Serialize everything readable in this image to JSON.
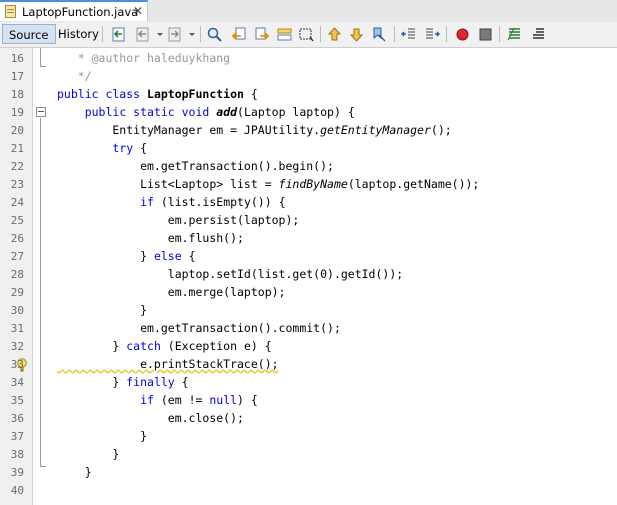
{
  "tab": {
    "title": "LaptopFunction.java",
    "close_glyph": "✕"
  },
  "toolbar": {
    "source_label": "Source",
    "history_label": "History"
  },
  "lines": [
    {
      "num": "16",
      "segs": [
        {
          "t": "   * @author haleduykhang",
          "c": "cmt"
        }
      ]
    },
    {
      "num": "17",
      "segs": [
        {
          "t": "   */",
          "c": "cmt"
        }
      ]
    },
    {
      "num": "18",
      "segs": [
        {
          "t": "public class ",
          "c": "kw"
        },
        {
          "t": "LaptopFunction",
          "c": "bold"
        },
        {
          "t": " {",
          "c": ""
        }
      ]
    },
    {
      "num": "19",
      "segs": [
        {
          "t": "    ",
          "c": ""
        },
        {
          "t": "public static void ",
          "c": "kw"
        },
        {
          "t": "add",
          "c": "bold ital"
        },
        {
          "t": "(Laptop laptop) {",
          "c": ""
        }
      ]
    },
    {
      "num": "20",
      "segs": [
        {
          "t": "        EntityManager em = JPAUtility.",
          "c": ""
        },
        {
          "t": "getEntityManager",
          "c": "ital"
        },
        {
          "t": "();",
          "c": ""
        }
      ]
    },
    {
      "num": "21",
      "segs": [
        {
          "t": "        ",
          "c": ""
        },
        {
          "t": "try",
          "c": "kw"
        },
        {
          "t": " {",
          "c": ""
        }
      ]
    },
    {
      "num": "22",
      "segs": [
        {
          "t": "            em.getTransaction().begin();",
          "c": ""
        }
      ]
    },
    {
      "num": "23",
      "segs": [
        {
          "t": "            List<Laptop> list = ",
          "c": ""
        },
        {
          "t": "findByName",
          "c": "ital"
        },
        {
          "t": "(laptop.getName());",
          "c": ""
        }
      ]
    },
    {
      "num": "24",
      "segs": [
        {
          "t": "            ",
          "c": ""
        },
        {
          "t": "if",
          "c": "kw"
        },
        {
          "t": " (list.isEmpty()) {",
          "c": ""
        }
      ]
    },
    {
      "num": "25",
      "segs": [
        {
          "t": "                em.persist(laptop);",
          "c": ""
        }
      ]
    },
    {
      "num": "26",
      "segs": [
        {
          "t": "                em.flush();",
          "c": ""
        }
      ]
    },
    {
      "num": "27",
      "segs": [
        {
          "t": "            } ",
          "c": ""
        },
        {
          "t": "else",
          "c": "kw"
        },
        {
          "t": " {",
          "c": ""
        }
      ]
    },
    {
      "num": "28",
      "segs": [
        {
          "t": "                laptop.setId(list.get(0).getId());",
          "c": ""
        }
      ]
    },
    {
      "num": "29",
      "segs": [
        {
          "t": "                em.merge(laptop);",
          "c": ""
        }
      ]
    },
    {
      "num": "30",
      "segs": [
        {
          "t": "            }",
          "c": ""
        }
      ]
    },
    {
      "num": "31",
      "segs": [
        {
          "t": "            em.getTransaction().commit();",
          "c": ""
        }
      ]
    },
    {
      "num": "32",
      "segs": [
        {
          "t": "        } ",
          "c": ""
        },
        {
          "t": "catch",
          "c": "kw"
        },
        {
          "t": " (Exception e) {",
          "c": ""
        }
      ]
    },
    {
      "num": "33",
      "segs": [
        {
          "t": "            e.printStackTrace();",
          "c": ""
        }
      ]
    },
    {
      "num": "34",
      "segs": [
        {
          "t": "        } ",
          "c": ""
        },
        {
          "t": "finally",
          "c": "kw"
        },
        {
          "t": " {",
          "c": ""
        }
      ]
    },
    {
      "num": "35",
      "segs": [
        {
          "t": "            ",
          "c": ""
        },
        {
          "t": "if",
          "c": "kw"
        },
        {
          "t": " (em != ",
          "c": ""
        },
        {
          "t": "null",
          "c": "kw"
        },
        {
          "t": ") {",
          "c": ""
        }
      ]
    },
    {
      "num": "36",
      "segs": [
        {
          "t": "                em.close();",
          "c": ""
        }
      ]
    },
    {
      "num": "37",
      "segs": [
        {
          "t": "            }",
          "c": ""
        }
      ]
    },
    {
      "num": "38",
      "segs": [
        {
          "t": "        }",
          "c": ""
        }
      ]
    },
    {
      "num": "39",
      "segs": [
        {
          "t": "    }",
          "c": ""
        }
      ]
    },
    {
      "num": "40",
      "segs": [
        {
          "t": "",
          "c": ""
        }
      ]
    }
  ],
  "colors": {
    "keyword": "#0000e6",
    "comment": "#969696",
    "accent": "#4a90d9"
  }
}
